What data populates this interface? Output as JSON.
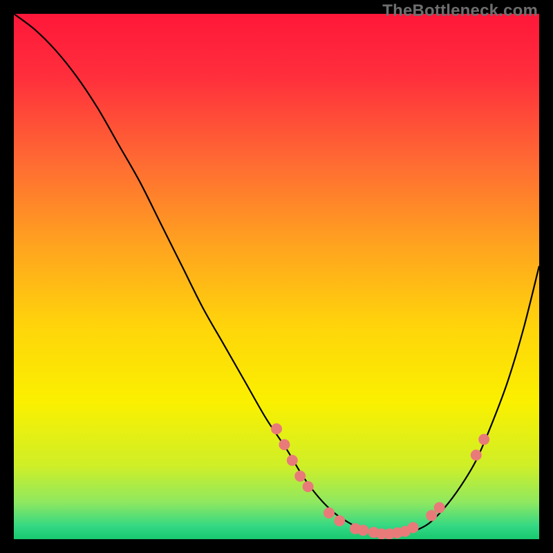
{
  "watermark": "TheBottleneck.com",
  "chart_data": {
    "type": "line",
    "title": "",
    "xlabel": "",
    "ylabel": "",
    "xlim": [
      0,
      100
    ],
    "ylim": [
      0,
      100
    ],
    "grid": false,
    "background_gradient": {
      "stops": [
        {
          "offset": 0.0,
          "color": "#ff173a"
        },
        {
          "offset": 0.12,
          "color": "#ff2f3c"
        },
        {
          "offset": 0.28,
          "color": "#ff6a33"
        },
        {
          "offset": 0.44,
          "color": "#ffa31f"
        },
        {
          "offset": 0.6,
          "color": "#ffd60a"
        },
        {
          "offset": 0.74,
          "color": "#faf000"
        },
        {
          "offset": 0.86,
          "color": "#cfef27"
        },
        {
          "offset": 0.93,
          "color": "#8fe860"
        },
        {
          "offset": 0.975,
          "color": "#34d884"
        },
        {
          "offset": 1.0,
          "color": "#17c86f"
        }
      ]
    },
    "series": [
      {
        "name": "bottleneck-curve",
        "stroke": "#000000",
        "stroke_width": 2.2,
        "x": [
          0,
          4,
          8,
          12,
          16,
          20,
          24,
          28,
          32,
          36,
          40,
          44,
          48,
          52,
          55,
          58,
          61,
          64,
          67,
          70,
          73,
          76,
          79,
          82,
          85,
          88,
          91,
          94,
          97,
          100
        ],
        "y": [
          100,
          97,
          93,
          88,
          82,
          75,
          68,
          60,
          52,
          44,
          37,
          30,
          23,
          17,
          12,
          8,
          5,
          3,
          1.5,
          1,
          1,
          1.5,
          3,
          6,
          10,
          15,
          22,
          30,
          40,
          52
        ]
      }
    ],
    "markers": {
      "name": "highlight-points",
      "fill": "#e97a7a",
      "r": 8,
      "points": [
        {
          "x": 50,
          "y": 21
        },
        {
          "x": 51.5,
          "y": 18
        },
        {
          "x": 53,
          "y": 15
        },
        {
          "x": 54.5,
          "y": 12
        },
        {
          "x": 56,
          "y": 10
        },
        {
          "x": 60,
          "y": 5
        },
        {
          "x": 62,
          "y": 3.5
        },
        {
          "x": 65,
          "y": 2
        },
        {
          "x": 66.5,
          "y": 1.7
        },
        {
          "x": 68.5,
          "y": 1.3
        },
        {
          "x": 70,
          "y": 1
        },
        {
          "x": 71.5,
          "y": 1
        },
        {
          "x": 73,
          "y": 1.2
        },
        {
          "x": 74.5,
          "y": 1.5
        },
        {
          "x": 76,
          "y": 2.2
        },
        {
          "x": 79.5,
          "y": 4.5
        },
        {
          "x": 81,
          "y": 6
        },
        {
          "x": 88,
          "y": 16
        },
        {
          "x": 89.5,
          "y": 19
        }
      ]
    }
  }
}
